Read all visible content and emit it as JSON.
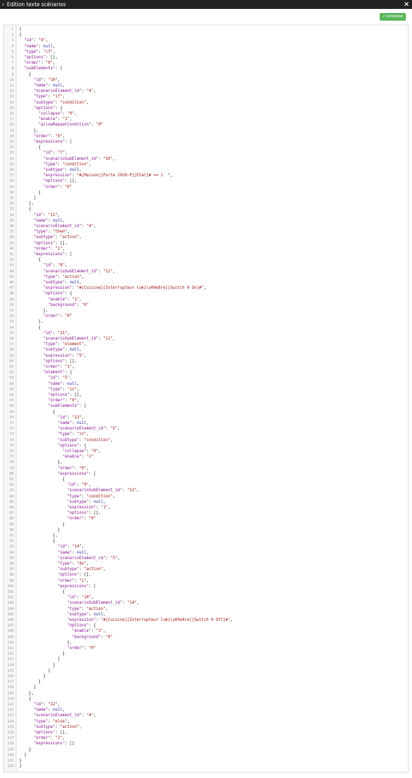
{
  "window": {
    "title": "Edition texte scénarios",
    "chevron_icon": "chevron-right-icon",
    "close_label": "×"
  },
  "toolbar": {
    "save_label": "Enregistrer",
    "save_icon": "✓"
  },
  "colors": {
    "titlebar_bg": "#222222",
    "save_button": "#5cb85c",
    "json_key": "#881391",
    "json_string": "#a11515",
    "json_literal": "#1a1aa6"
  },
  "editor": {
    "lines": [
      "[",
      "{",
      "  \"id\": \"4\",",
      "  \"name\": null,",
      "  \"type\": \"if\",",
      "  \"options\": [],",
      "  \"order\": \"0\",",
      "  \"subElements\": [",
      "    {",
      "      \"id\": \"10\",",
      "      \"name\": null,",
      "      \"scenarioElement_id\": \"4\",",
      "      \"type\": \"if\",",
      "      \"subtype\": \"condition\",",
      "      \"options\": {",
      "        \"collapse\": \"0\",",
      "        \"enable\": \"1\",",
      "        \"allowRepeatCondition\": \"0\"",
      "      },",
      "      \"order\": \"0\",",
      "      \"expressions\": [",
      "        {",
      "          \"id\": \"7\",",
      "          \"scenarioSubElement_id\": \"10\",",
      "          \"type\": \"condition\",",
      "          \"subtype\": null,",
      "          \"expression\": \"#[Maison][Porte 2020-P][Etat]# == 1  \",",
      "          \"options\": [],",
      "          \"order\": \"0\"",
      "        }",
      "      ]",
      "    },",
      "    {",
      "      \"id\": \"11\",",
      "      \"name\": null,",
      "      \"scenarioElement_id\": \"4\",",
      "      \"type\": \"then\",",
      "      \"subtype\": \"action\",",
      "      \"options\": [],",
      "      \"order\": \"1\",",
      "      \"expressions\": [",
      "        {",
      "          \"id\": \"8\",",
      "          \"scenarioSubElement_id\": \"11\",",
      "          \"type\": \"action\",",
      "          \"subtype\": null,",
      "          \"expression\": \"#[Cuisine][Interrupteur lumi\\u00e8re][Switch 0 On]#\",",
      "          \"options\": {",
      "            \"enable\": \"1\",",
      "            \"background\": \"0\"",
      "          },",
      "          \"order\": \"0\"",
      "        },",
      "        {",
      "          \"id\": \"11\",",
      "          \"scenarioSubElement_id\": \"11\",",
      "          \"type\": \"element\",",
      "          \"subtype\": null,",
      "          \"expression\": \"5\",",
      "          \"options\": [],",
      "          \"order\": \"1\",",
      "          \"element\": {",
      "            \"id\": \"5\",",
      "            \"name\": null,",
      "            \"type\": \"in\",",
      "            \"options\": [],",
      "            \"order\": \"0\",",
      "            \"subElements\": [",
      "              {",
      "                \"id\": \"13\",",
      "                \"name\": null,",
      "                \"scenarioElement_id\": \"5\",",
      "                \"type\": \"in\",",
      "                \"subtype\": \"condition\",",
      "                \"options\": {",
      "                  \"collapse\": \"0\",",
      "                  \"enable\": \"1\"",
      "                },",
      "                \"order\": \"0\",",
      "                \"expressions\": [",
      "                  {",
      "                    \"id\": \"9\",",
      "                    \"scenarioSubElement_id\": \"13\",",
      "                    \"type\": \"condition\",",
      "                    \"subtype\": null,",
      "                    \"expression\": \"1\",",
      "                    \"options\": [],",
      "                    \"order\": \"0\"",
      "                  }",
      "                ]",
      "              },",
      "              {",
      "                \"id\": \"14\",",
      "                \"name\": null,",
      "                \"scenarioElement_id\": \"5\",",
      "                \"type\": \"do\",",
      "                \"subtype\": \"action\",",
      "                \"options\": [],",
      "                \"order\": \"1\",",
      "                \"expressions\": [",
      "                  {",
      "                    \"id\": \"10\",",
      "                    \"scenarioSubElement_id\": \"14\",",
      "                    \"type\": \"action\",",
      "                    \"subtype\": null,",
      "                    \"expression\": \"#[Cuisine][Interrupteur lumi\\u00e8re][Switch 0 Off]#\",",
      "                    \"options\": {",
      "                      \"enable\": \"1\",",
      "                      \"background\": \"0\"",
      "                    },",
      "                    \"order\": \"0\"",
      "                  }",
      "                ]",
      "              }",
      "            ]",
      "          }",
      "        }",
      "      ]",
      "    },",
      "    {",
      "      \"id\": \"12\",",
      "      \"name\": null,",
      "      \"scenarioElement_id\": \"4\",",
      "      \"type\": \"else\",",
      "      \"subtype\": \"action\",",
      "      \"options\": [],",
      "      \"order\": \"2\",",
      "      \"expressions\": []",
      "    }",
      "  ]",
      "}",
      "]"
    ]
  }
}
